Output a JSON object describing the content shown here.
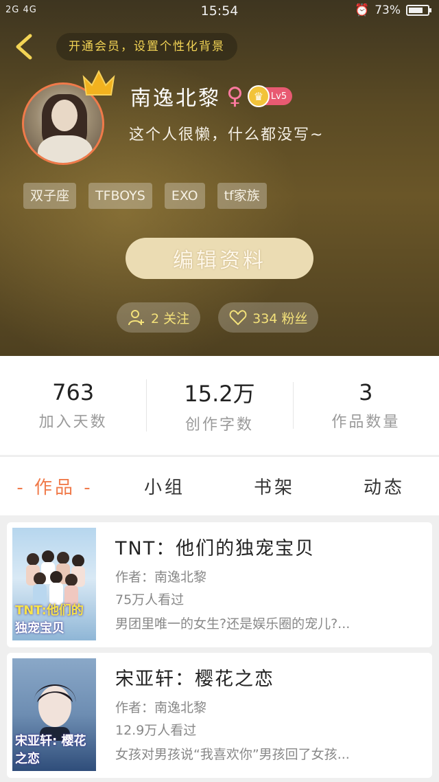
{
  "status_bar": {
    "left": "2G 4G",
    "time": "15:54",
    "battery": "73%"
  },
  "header": {
    "vip_banner": "开通会员，设置个性化背景",
    "username": "南逸北黎",
    "gender_symbol": "♀",
    "level": "Lv5",
    "signature": "这个人很懒，什么都没写~",
    "tags": [
      "双子座",
      "TFBOYS",
      "EXO",
      "tf家族"
    ],
    "edit_button": "编辑资料",
    "following": "2 关注",
    "fans": "334 粉丝"
  },
  "stats": [
    {
      "value": "763",
      "label": "加入天数"
    },
    {
      "value": "15.2万",
      "label": "创作字数"
    },
    {
      "value": "3",
      "label": "作品数量"
    }
  ],
  "tabs": [
    {
      "label": "- 作品 -",
      "active": true
    },
    {
      "label": "小组",
      "active": false
    },
    {
      "label": "书架",
      "active": false
    },
    {
      "label": "动态",
      "active": false
    }
  ],
  "works": [
    {
      "title": "TNT：他们的独宠宝贝",
      "author": "作者：南逸北黎",
      "views": "75万人看过",
      "desc": "男团里唯一的女生?还是娱乐圈的宠儿?...",
      "cover_line1": "TNT:他们的",
      "cover_line2": "独宠宝贝"
    },
    {
      "title": "宋亚轩：樱花之恋",
      "author": "作者：南逸北黎",
      "views": "12.9万人看过",
      "desc": "女孩对男孩说“我喜欢你”男孩回了女孩...",
      "cover_line1": "宋亚轩:",
      "cover_line2": "樱花之恋"
    }
  ],
  "colors": {
    "accent": "#f07a4a",
    "gold": "#f4e27a",
    "level_badge": "#e85a72"
  }
}
